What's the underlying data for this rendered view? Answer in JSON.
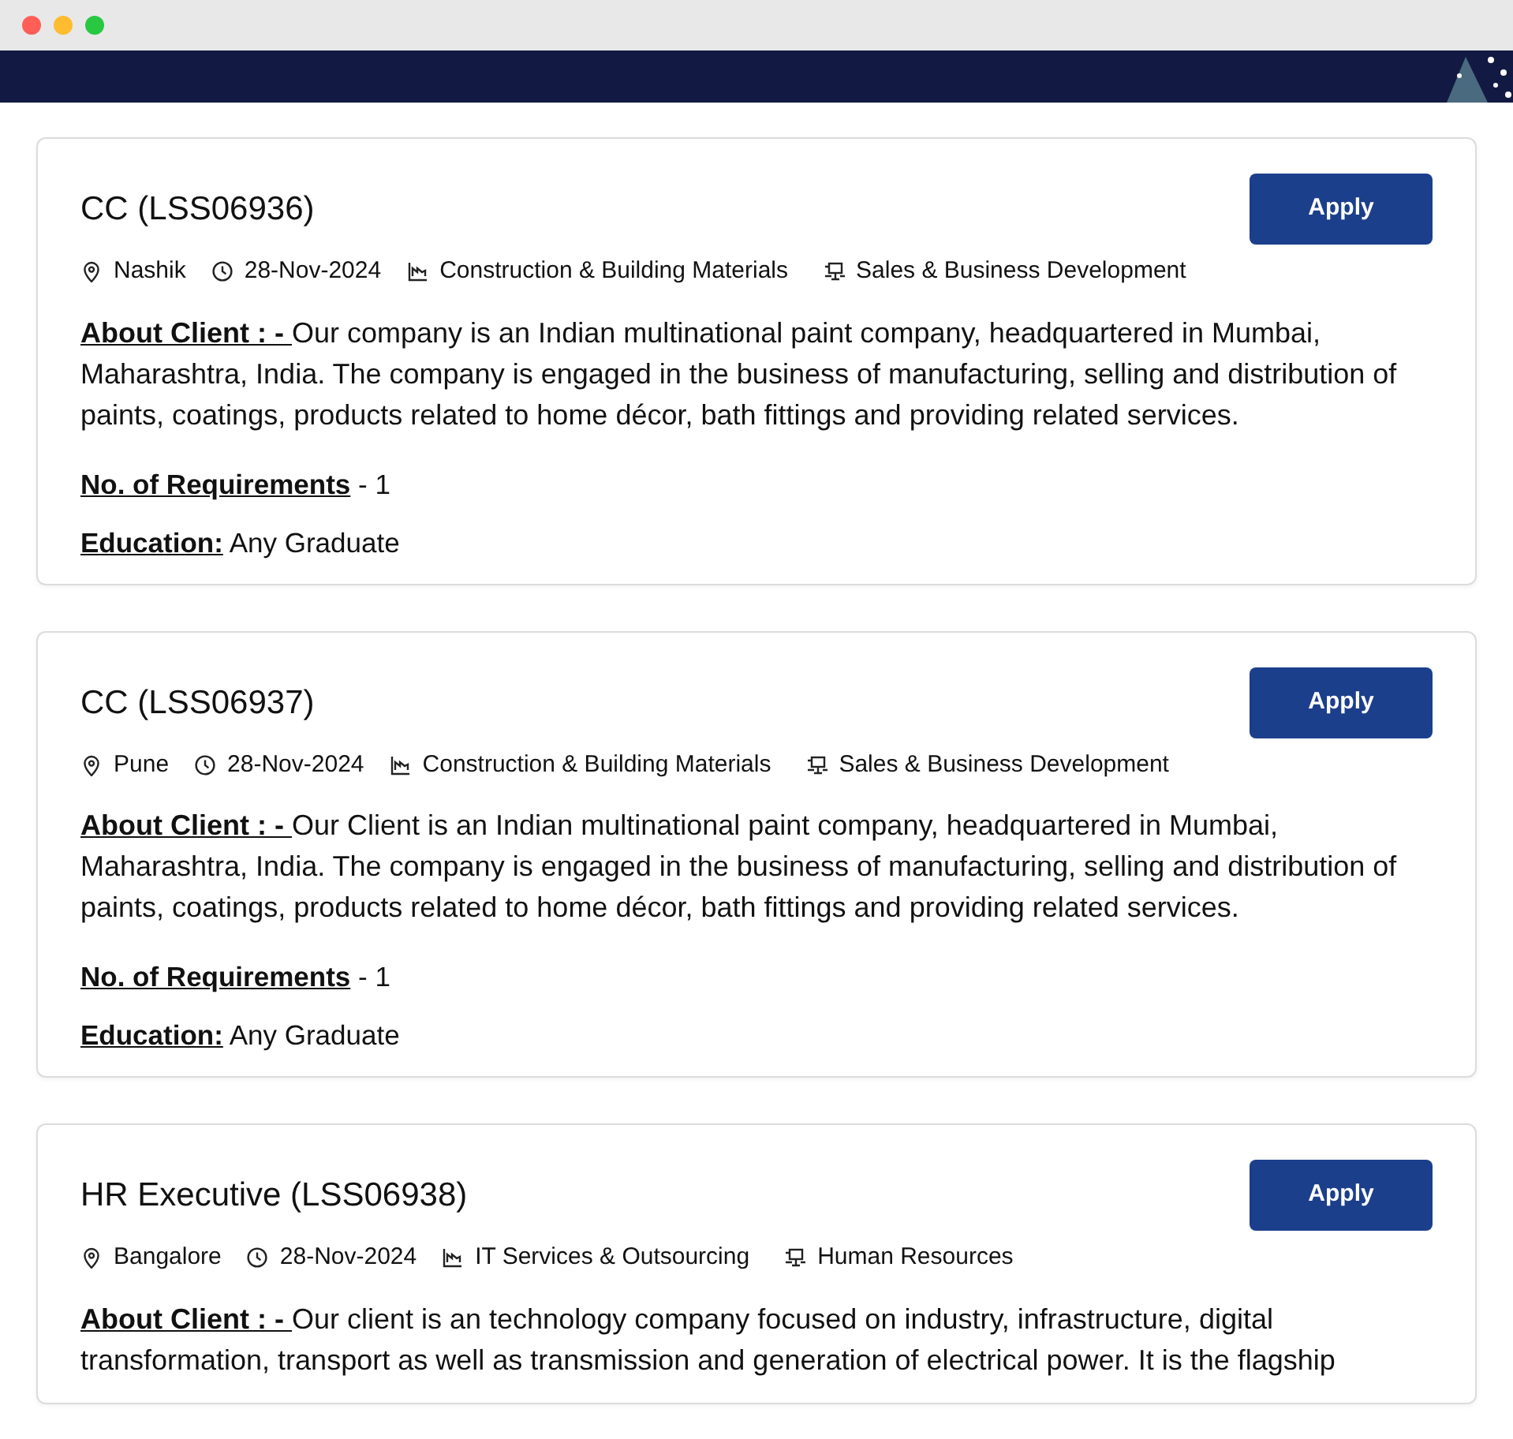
{
  "jobs": [
    {
      "title": "CC (LSS06936)",
      "button": "Apply",
      "location": "Nashik",
      "date": "28-Nov-2024",
      "industry": "Construction & Building Materials",
      "function": "Sales & Business Development",
      "about_label": "About Client : - ",
      "about": "Our company is an Indian multinational paint company, headquartered in Mumbai, Maharashtra, India. The company is engaged in the business of manufacturing, selling and distribution of paints, coatings, products related to home décor, bath fittings and providing related services.",
      "requirements_label": "No. of Requirements",
      "requirements": " - 1",
      "education_label": "Education:",
      "education": " Any Graduate"
    },
    {
      "title": "CC (LSS06937)",
      "button": "Apply",
      "location": "Pune",
      "date": "28-Nov-2024",
      "industry": "Construction & Building Materials",
      "function": "Sales & Business Development",
      "about_label": "About Client : - ",
      "about": "Our Client is an Indian multinational paint company, headquartered in Mumbai, Maharashtra, India. The company is engaged in the business of manufacturing, selling and distribution of paints, coatings, products related to home décor, bath fittings and providing related services.",
      "requirements_label": "No. of Requirements",
      "requirements": " - 1",
      "education_label": "Education:",
      "education": " Any Graduate"
    },
    {
      "title": "HR Executive (LSS06938)",
      "button": "Apply",
      "location": "Bangalore",
      "date": "28-Nov-2024",
      "industry": "IT Services & Outsourcing",
      "function": "Human Resources",
      "about_label": "About Client : - ",
      "about": "Our client is an technology company focused on industry, infrastructure, digital transformation, transport as well as transmission and generation of electrical power. It is the flagship"
    }
  ]
}
